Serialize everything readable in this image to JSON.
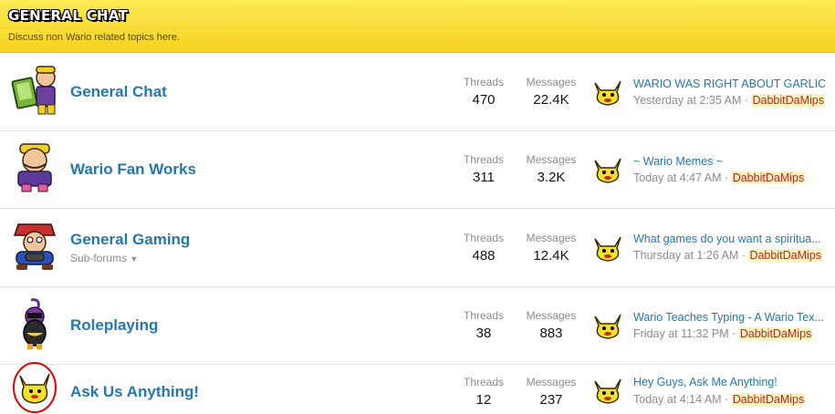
{
  "category": {
    "title": "General Chat",
    "description": "Discuss non Wario related topics here."
  },
  "labels": {
    "threads": "Threads",
    "messages": "Messages"
  },
  "nodes": [
    {
      "title": "General Chat",
      "threads": "470",
      "messages": "22.4K",
      "last_post_title": "WARIO WAS RIGHT ABOUT GARLIC",
      "last_post_time": "Yesterday at 2:35 AM",
      "last_post_user": "DabbitDaMips"
    },
    {
      "title": "Wario Fan Works",
      "threads": "311",
      "messages": "3.2K",
      "last_post_title": "~ Wario Memes ~",
      "last_post_time": "Today at 4:47 AM",
      "last_post_user": "DabbitDaMips"
    },
    {
      "title": "General Gaming",
      "subforums": "Sub-forums",
      "threads": "488",
      "messages": "12.4K",
      "last_post_title": "What games do you want a spiritua...",
      "last_post_time": "Thursday at 1:26 AM",
      "last_post_user": "DabbitDaMips"
    },
    {
      "title": "Roleplaying",
      "threads": "38",
      "messages": "883",
      "last_post_title": "Wario Teaches Typing - A Wario Tex...",
      "last_post_time": "Friday at 11:32 PM",
      "last_post_user": "DabbitDaMips"
    },
    {
      "title": "Ask Us Anything!",
      "threads": "12",
      "messages": "237",
      "last_post_title": "Hey Guys, Ask Me Anything!",
      "last_post_time": "Today at 4:14 AM",
      "last_post_user": "DabbitDaMips"
    }
  ],
  "separator": " · ",
  "colors": {
    "header": "#f7d21e",
    "link": "#2577b1",
    "username": "#c02323",
    "annotation": "#e00000"
  }
}
